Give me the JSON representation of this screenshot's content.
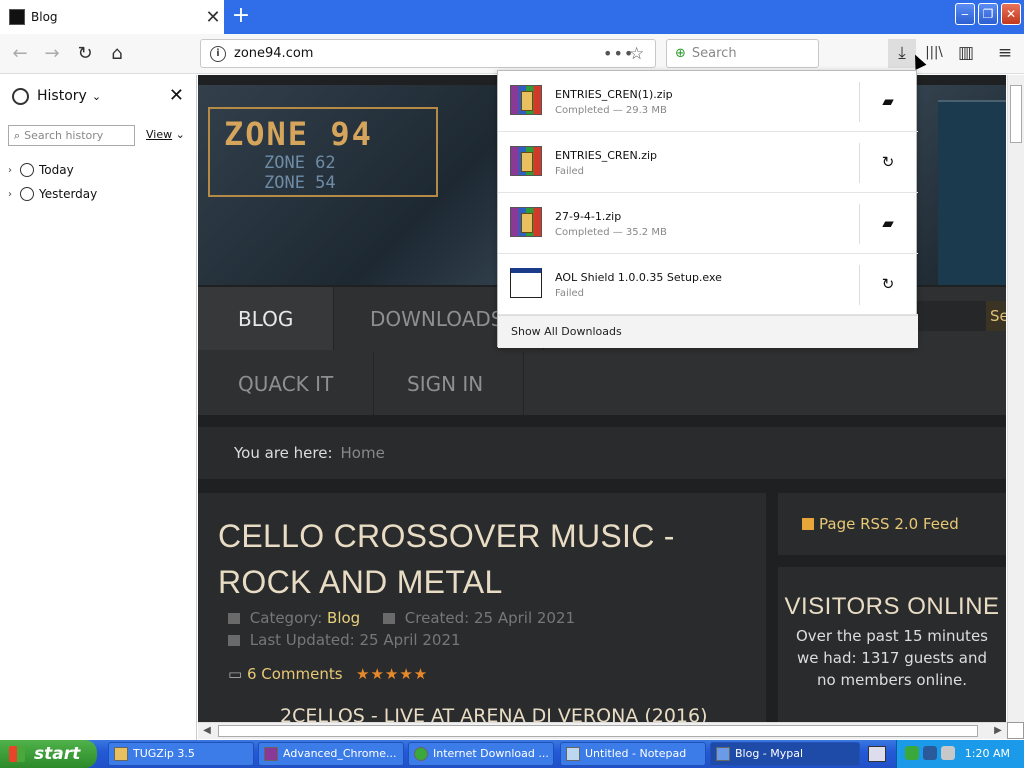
{
  "browser": {
    "tab": {
      "title": "Blog",
      "close": "✕"
    },
    "new_tab": "+",
    "window_controls": {
      "minimize": "‒",
      "restore": "❐",
      "close": "✕"
    },
    "nav": {
      "back": "←",
      "forward": "→",
      "reload": "↻",
      "home": "⌂"
    },
    "url": "zone94.com",
    "page_actions": "•••",
    "bookmark_star": "☆",
    "search_placeholder": "Search",
    "toolbar": {
      "download": "⤓",
      "library": "|||\\",
      "sidebar": "▥",
      "menu": "≡"
    }
  },
  "sidebar": {
    "title": "History",
    "close": "✕",
    "search_placeholder": "Search history",
    "view_label": "View",
    "groups": [
      {
        "label": "Today"
      },
      {
        "label": "Yesterday"
      }
    ]
  },
  "downloads": {
    "items": [
      {
        "name": "ENTRIES_CREN(1).zip",
        "status": "Completed — 29.3 MB",
        "icon": "winrar-archive-icon",
        "action": "folder-icon",
        "action_glyph": "▰"
      },
      {
        "name": "ENTRIES_CREN.zip",
        "status": "Failed",
        "icon": "winrar-archive-icon",
        "action": "retry-icon",
        "action_glyph": "↻"
      },
      {
        "name": "27-9-4-1.zip",
        "status": "Completed — 35.2 MB",
        "icon": "winrar-archive-icon",
        "action": "folder-icon",
        "action_glyph": "▰"
      },
      {
        "name": "AOL Shield 1.0.0.35 Setup.exe",
        "status": "Failed",
        "icon": "exe-window-icon",
        "action": "retry-icon",
        "action_glyph": "↻"
      }
    ],
    "show_all": "Show All Downloads"
  },
  "site": {
    "logo": {
      "main": "ZONE 94",
      "sub1": "ZONE 62",
      "sub2": "ZONE 54"
    },
    "menu": [
      "BLOG",
      "DOWNLOADS",
      "QUACK IT",
      "SIGN IN"
    ],
    "search_button": "Se",
    "breadcrumb": {
      "label": "You are here:",
      "home": "Home"
    },
    "article": {
      "title": "CELLO CROSSOVER MUSIC - ROCK AND METAL",
      "category_label": "Category:",
      "category": "Blog",
      "created": "Created: 25 April 2021",
      "updated": "Last Updated: 25 April 2021",
      "comments": "6 Comments",
      "rating_stars": 5,
      "stars": "★★★★★",
      "subtitle": "2CELLOS - LIVE AT ARENA DI VERONA (2016)"
    },
    "rss": "Page RSS 2.0 Feed",
    "visitors": {
      "title": "VISITORS ONLINE",
      "body": "Over the past 15 minutes we had: 1317 guests and no members online."
    }
  },
  "taskbar": {
    "start": "start",
    "tasks": [
      {
        "label": "TUGZip 3.5"
      },
      {
        "label": "Advanced_Chrome..."
      },
      {
        "label": "Internet Download ..."
      },
      {
        "label": "Untitled - Notepad"
      },
      {
        "label": "Blog - Mypal"
      }
    ],
    "clock": "1:20 AM"
  },
  "colors": {
    "title_bar": "#2f6ee8",
    "site_bg": "#1f2021",
    "accent_gold": "#e8c875",
    "taskbar": "#245ad6",
    "start_green": "#3a9a36"
  }
}
